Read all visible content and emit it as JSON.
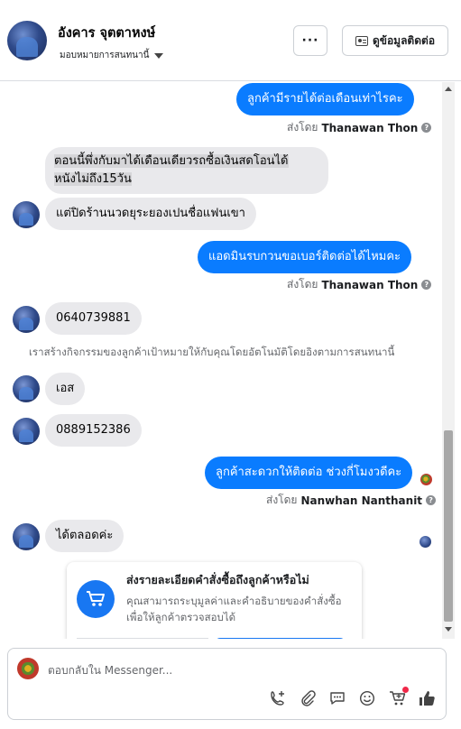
{
  "header": {
    "contact_name": "อังคาร จุตตาหงษ์",
    "assign_label": "มอบหมายการสนทนานี้",
    "more_label": "···",
    "contact_info_label": "ดูข้อมูลติดต่อ"
  },
  "messages": [
    {
      "direction": "out",
      "text": "ลูกค้ามีรายได้ต่อเดือนเท่าไรคะ",
      "sent_by_prefix": "ส่งโดย",
      "sent_by_name": "Thanawan Thon"
    },
    {
      "direction": "in",
      "text_line1": "ตอนนี้พึ่งกับมาได้เดือนเดียวรถซื้อเงินสดโอนได้",
      "text_line2": "หนังไม่ถึง15วัน"
    },
    {
      "direction": "in",
      "text": "แต่ปิดร้านนวดยุระยองเปนชื่อแฟนเขา"
    },
    {
      "direction": "out",
      "text": "แอดมินรบกวนขอเบอร์ติดต่อได้ไหมคะ",
      "sent_by_prefix": "ส่งโดย",
      "sent_by_name": "Thanawan Thon"
    },
    {
      "direction": "in",
      "text": "0640739881"
    },
    {
      "direction": "system",
      "text": "เราสร้างกิจกรรมของลูกค้าเป้าหมายให้กับคุณโดยอัตโนมัติโดยอิงตามการสนทนานี้"
    },
    {
      "direction": "in",
      "text": "เอส"
    },
    {
      "direction": "in",
      "text": "0889152386"
    },
    {
      "direction": "out",
      "text": "ลูกค้าสะดวกให้ติดต่อ ช่วงกี่โมงวดีคะ",
      "sent_by_prefix": "ส่งโดย",
      "sent_by_name": "Nanwhan Nanthanit"
    },
    {
      "direction": "in",
      "text": "ได้ตลอดค่ะ"
    }
  ],
  "order_card": {
    "title": "ส่งรายละเอียดคำสั่งซื้อถึงลูกค้าหรือไม่",
    "body": "คุณสามารถระบุมูลค่าและคำอธิบายของคำสั่งซื้อเพื่อให้ลูกค้าตรวจสอบได้"
  },
  "composer": {
    "placeholder": "ตอบกลับใน Messenger..."
  },
  "icons": [
    "more-icon",
    "contact-card-icon",
    "help-icon",
    "cart-icon",
    "add-call-icon",
    "attach-icon",
    "saved-reply-icon",
    "emoji-icon",
    "cart-order-icon",
    "like-icon"
  ],
  "colors": {
    "outgoing_bubble": "#0a7cff",
    "incoming_bubble": "#e9e9ec",
    "accent": "#1877f2",
    "notification": "#f02849"
  }
}
